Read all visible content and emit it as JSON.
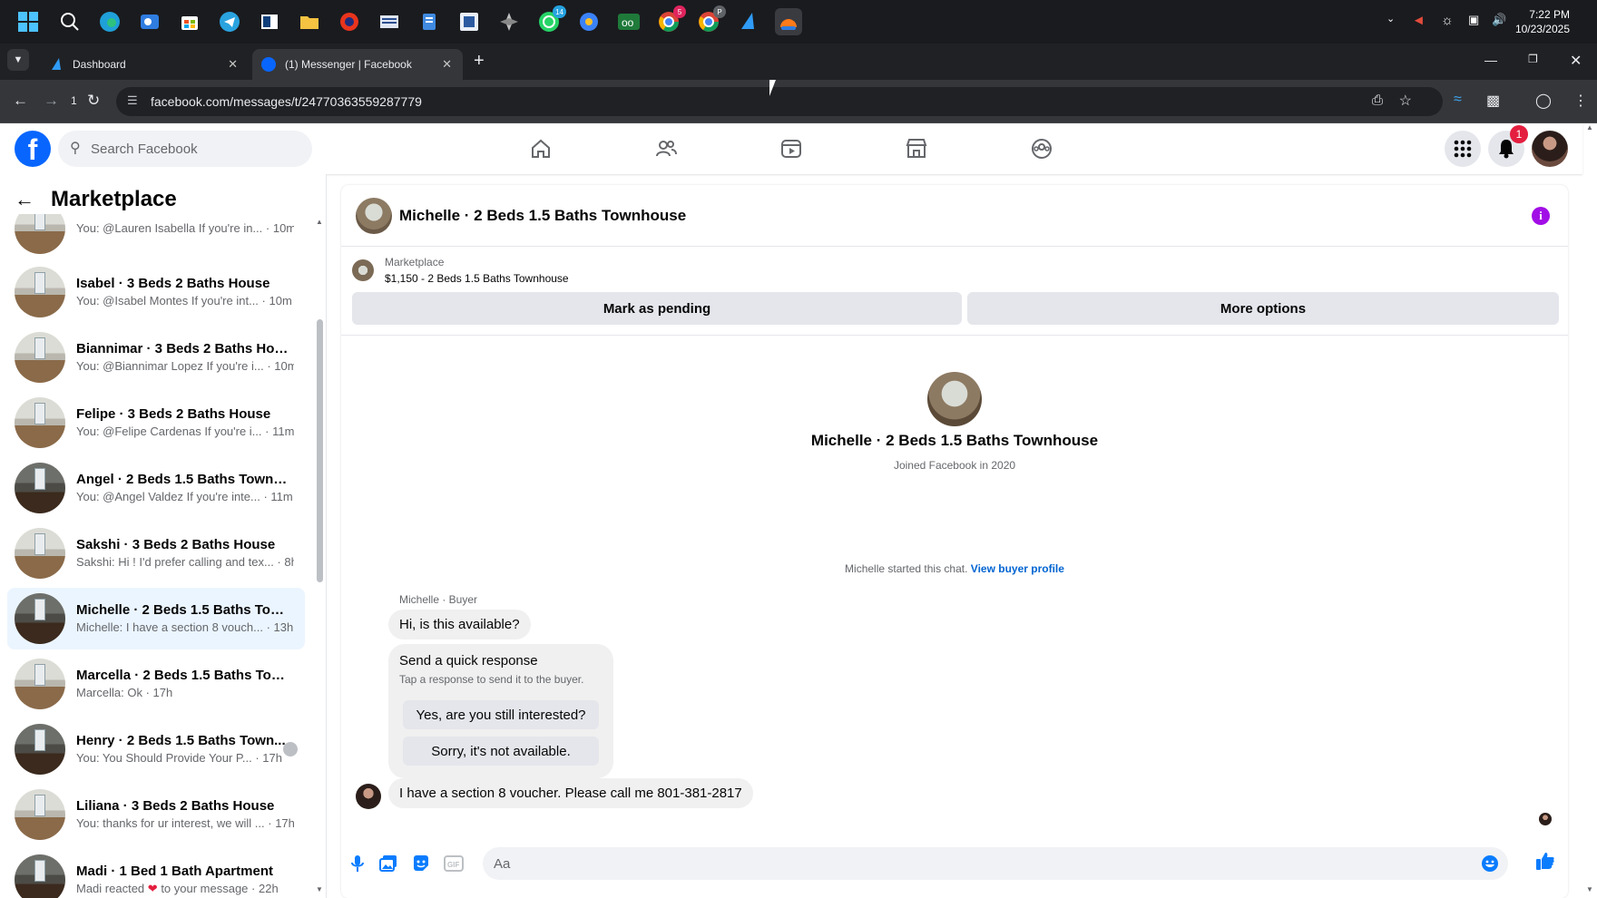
{
  "taskbar": {
    "icons": [
      "windows-start-icon",
      "search-icon",
      "edge-icon",
      "outlook-icon",
      "store-icon",
      "telegram-icon",
      "app-icon",
      "file-explorer-icon",
      "media-icon",
      "news-icon",
      "notepad-icon",
      "snipping-icon",
      "ai-icon",
      "whatsapp-icon",
      "copilot-icon",
      "infinity-icon",
      "chrome-icon",
      "chrome-profile-icon",
      "sail-icon",
      "vpn-icon"
    ],
    "whatsapp_badge": "14",
    "chrome_badge": "5",
    "chrome2_badge": "P",
    "time": "7:22 PM",
    "date": "10/23/2025"
  },
  "browser": {
    "tabs": [
      {
        "label": "Dashboard",
        "active": false
      },
      {
        "label": "(1) Messenger | Facebook",
        "active": true
      }
    ],
    "new_tab": "+",
    "history_count": "1",
    "url": "facebook.com/messages/t/24770363559287779"
  },
  "facebook": {
    "search_placeholder": "Search Facebook",
    "notifications_count": "1",
    "nav_icons": [
      "home-icon",
      "friends-icon",
      "video-icon",
      "marketplace-icon",
      "groups-icon"
    ]
  },
  "sidebar": {
    "title": "Marketplace",
    "conversations": [
      {
        "name": "",
        "preview": "You: @Lauren Isabella If you're in...",
        "time": "10m",
        "partial": true
      },
      {
        "name": "Isabel · 3 Beds 2 Baths House",
        "preview": "You: @Isabel Montes If you're int...",
        "time": "10m"
      },
      {
        "name": "Biannimar · 3 Beds 2 Baths House",
        "preview": "You: @Biannimar Lopez If you're i...",
        "time": "10m"
      },
      {
        "name": "Felipe · 3 Beds 2 Baths House",
        "preview": "You: @Felipe Cardenas If you're i...",
        "time": "11m"
      },
      {
        "name": "Angel · 2 Beds 1.5 Baths Townho...",
        "preview": "You: @Angel Valdez If you're inte...",
        "time": "11m"
      },
      {
        "name": "Sakshi · 3 Beds 2 Baths House",
        "preview": "Sakshi: Hi ! I'd prefer calling and tex...",
        "time": "8h"
      },
      {
        "name": "Michelle · 2 Beds 1.5 Baths Town...",
        "preview": "Michelle: I have a section 8 vouch...",
        "time": "13h",
        "active": true
      },
      {
        "name": "Marcella · 2 Beds 1.5 Baths Town...",
        "preview": "Marcella: Ok",
        "time": "17h"
      },
      {
        "name": "Henry · 2 Beds 1.5 Baths Town...",
        "preview": "You: You Should Provide Your P...",
        "time": "17h"
      },
      {
        "name": "Liliana · 3 Beds 2 Baths House",
        "preview": "You: thanks for ur interest, we will ...",
        "time": "17h"
      },
      {
        "name": "Madi · 1 Bed 1 Bath Apartment",
        "preview_before": "Madi reacted",
        "preview_after": "to your message",
        "time": "22h"
      }
    ]
  },
  "chat": {
    "title": "Michelle · 2 Beds 1.5 Baths Townhouse",
    "listing_label": "Marketplace",
    "listing_price": "$1,150 - 2 Beds 1.5 Baths Townhouse",
    "mark_pending": "Mark as pending",
    "more_options": "More options",
    "intro_name": "Michelle · 2 Beds 1.5 Baths Townhouse",
    "intro_joined": "Joined Facebook in 2020",
    "started_text": "Michelle started this chat.",
    "view_profile": "View buyer profile",
    "sender_label": "Michelle · Buyer",
    "message1": "Hi, is this available?",
    "quick_title": "Send a quick response",
    "quick_sub": "Tap a response to send it to the buyer.",
    "quick1": "Yes, are you still interested?",
    "quick2": "Sorry, it's not available.",
    "message2": "I have a section 8 voucher.  Please call me 801-381-2817",
    "input_placeholder": "Aa"
  },
  "colors": {
    "fb_blue": "#0866ff",
    "messenger_blue": "#0a7cff",
    "active_row": "#ebf5ff",
    "info_purple": "#a10ee6"
  }
}
